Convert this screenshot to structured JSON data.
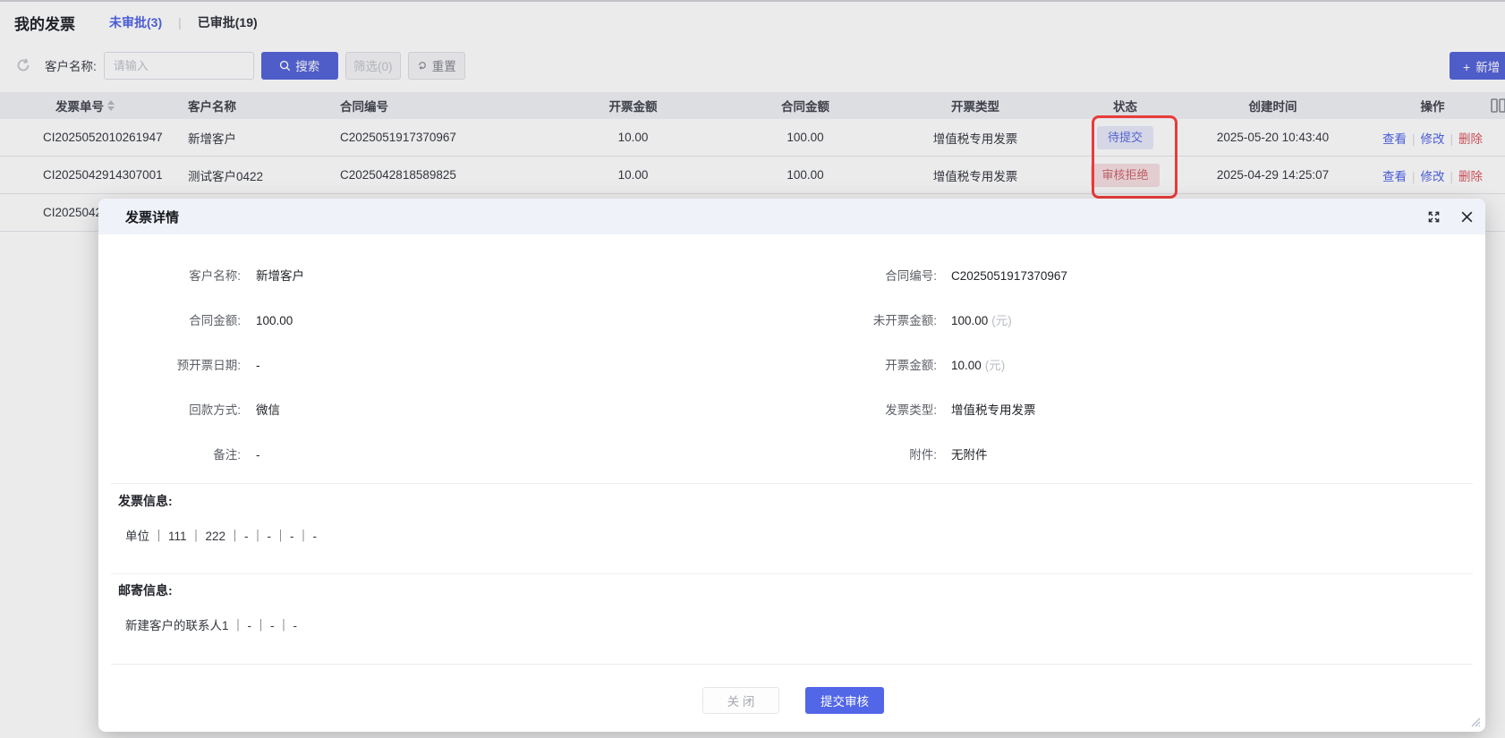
{
  "page": {
    "title": "我的发票",
    "tabs": [
      {
        "label": "未审批(3)",
        "active": true
      },
      {
        "label": "已审批(19)",
        "active": false
      }
    ],
    "filter": {
      "customer_label": "客户名称:",
      "input_placeholder": "请输入",
      "input_value": "",
      "search_label": "搜索",
      "filter_label": "筛选(0)",
      "reset_label": "重置",
      "add_label": "新增"
    },
    "table": {
      "headers": [
        "发票单号",
        "客户名称",
        "合同编号",
        "开票金额",
        "合同金额",
        "开票类型",
        "状态",
        "创建时间",
        "操作"
      ],
      "rows": [
        {
          "invoice_no": "CI2025052010261947",
          "customer": "新增客户",
          "contract_no": "C2025051917370967",
          "invoice_amount": "10.00",
          "contract_amount": "100.00",
          "invoice_type": "增值税专用发票",
          "status": "待提交",
          "status_type": "pending",
          "created": "2025-05-20 10:43:40",
          "actions": [
            "查看",
            "修改",
            "删除"
          ]
        },
        {
          "invoice_no": "CI2025042914307001",
          "customer": "测试客户0422",
          "contract_no": "C2025042818589825",
          "invoice_amount": "10.00",
          "contract_amount": "100.00",
          "invoice_type": "增值税专用发票",
          "status": "审核拒绝",
          "status_type": "rejected",
          "created": "2025-04-29 14:25:07",
          "actions": [
            "查看",
            "修改",
            "删除"
          ]
        },
        {
          "invoice_no": "CI2025042",
          "partial": true
        }
      ]
    }
  },
  "modal": {
    "title": "发票详情",
    "fields_left": [
      {
        "label": "客户名称:",
        "value": "新增客户"
      },
      {
        "label": "合同金额:",
        "value": "100.00"
      },
      {
        "label": "预开票日期:",
        "value": "-"
      },
      {
        "label": "回款方式:",
        "value": "微信"
      },
      {
        "label": "备注:",
        "value": "-"
      }
    ],
    "fields_right": [
      {
        "label": "合同编号:",
        "value": "C2025051917370967",
        "unit": ""
      },
      {
        "label": "未开票金额:",
        "value": "100.00",
        "unit": "(元)"
      },
      {
        "label": "开票金额:",
        "value": "10.00",
        "unit": "(元)"
      },
      {
        "label": "发票类型:",
        "value": "增值税专用发票",
        "unit": ""
      },
      {
        "label": "附件:",
        "value": "无附件",
        "unit": ""
      }
    ],
    "invoice_info": {
      "heading": "发票信息:",
      "line": "单位 ｜ 111 ｜ 222 ｜ - ｜ - ｜ - ｜ -"
    },
    "mail_info": {
      "heading": "邮寄信息:",
      "line": "新建客户的联系人1 ｜ - ｜ - ｜ -"
    },
    "footer": {
      "close_label": "关 闭",
      "submit_label": "提交审核"
    }
  },
  "colors": {
    "accent_blue": "#5266e8",
    "annotation_red": "#e93b3b",
    "status_pending_bg": "#e7eafa",
    "status_pending_text": "#5a6ade",
    "status_rejected_bg": "#f6dfe1",
    "status_rejected_text": "#d0646b",
    "link_blue": "#5064e5",
    "link_danger": "#d9555c"
  }
}
